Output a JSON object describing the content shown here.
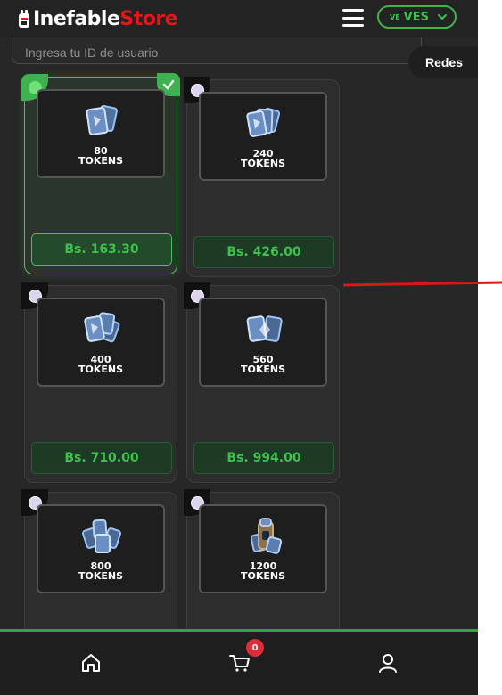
{
  "header": {
    "logo_part1": "Inefable",
    "logo_part2": "Store",
    "currency": {
      "flag": "VE",
      "code": "VES"
    }
  },
  "user_id_input": {
    "placeholder": "Ingresa tu ID de usuario",
    "value": ""
  },
  "redes_button": "Redes",
  "products": [
    {
      "amount": "80",
      "unit": "TOKENS",
      "price": "Bs. 163.30",
      "selected": true
    },
    {
      "amount": "240",
      "unit": "TOKENS",
      "price": "Bs. 426.00",
      "selected": false
    },
    {
      "amount": "400",
      "unit": "TOKENS",
      "price": "Bs. 710.00",
      "selected": false
    },
    {
      "amount": "560",
      "unit": "TOKENS",
      "price": "Bs. 994.00",
      "selected": false
    },
    {
      "amount": "800",
      "unit": "TOKENS",
      "price": "",
      "selected": false
    },
    {
      "amount": "1200",
      "unit": "TOKENS",
      "price": "",
      "selected": false
    }
  ],
  "bottom_nav": {
    "items": [
      "home-icon",
      "cart-icon",
      "user-icon"
    ],
    "cart_count": "0"
  },
  "colors": {
    "accent": "#3fb24f",
    "brand_red": "#e0171c",
    "badge": "#e02b3a"
  }
}
